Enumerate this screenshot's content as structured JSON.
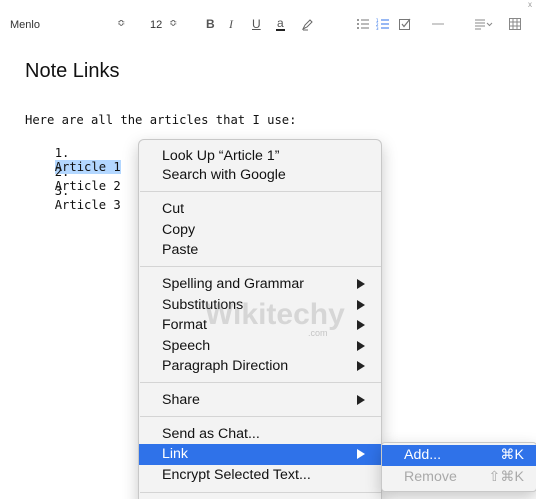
{
  "toolbar": {
    "font": "Menlo",
    "font_size": "12",
    "bold": "B",
    "italic": "I",
    "underline": "U",
    "color": "a",
    "stepper_glyph": "≎",
    "corner_mark": "x"
  },
  "document": {
    "title": "Note Links",
    "intro": "Here are all the articles that I use:",
    "items": [
      {
        "num": "1.",
        "text": "Article 1"
      },
      {
        "num": "2.",
        "text": "Article 2"
      },
      {
        "num": "3.",
        "text": "Article 3"
      }
    ]
  },
  "context_menu": {
    "look_up": "Look Up “Article 1”",
    "search": "Search with Google",
    "cut": "Cut",
    "copy": "Copy",
    "paste": "Paste",
    "spelling": "Spelling and Grammar",
    "substitutions": "Substitutions",
    "format": "Format",
    "speech": "Speech",
    "paragraph": "Paragraph Direction",
    "share": "Share",
    "send_chat": "Send as Chat...",
    "link": "Link",
    "encrypt": "Encrypt Selected Text..."
  },
  "link_submenu": {
    "add": "Add...",
    "add_shortcut": "⌘K",
    "remove": "Remove",
    "remove_shortcut": "⇧⌘K"
  },
  "watermark": {
    "brand": "Wikitechy",
    "domain": ".com"
  },
  "colors": {
    "highlight": "#2f72e9",
    "selection": "#b3d7ff"
  }
}
